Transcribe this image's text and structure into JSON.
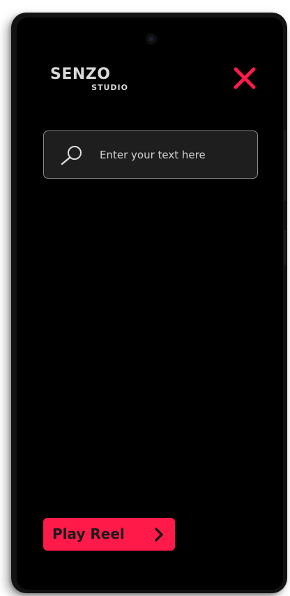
{
  "app": {
    "logo_main": "SENZO",
    "logo_sub": "STUDIO"
  },
  "header": {
    "close_icon": "close-icon",
    "accent_color": "#ff1a4a"
  },
  "search": {
    "icon": "search-icon",
    "placeholder": "Enter your text here",
    "value": ""
  },
  "footer": {
    "play_reel_label": "Play Reel",
    "play_reel_icon": "chevron-right-icon",
    "button_color": "#ff1a4a"
  }
}
